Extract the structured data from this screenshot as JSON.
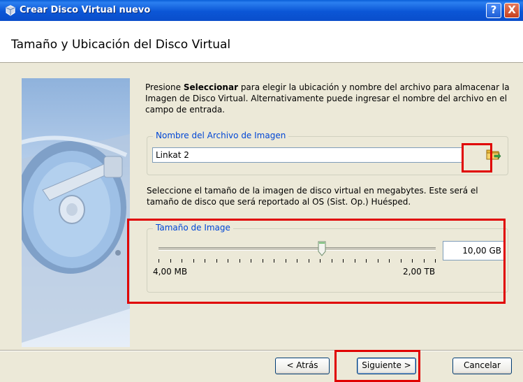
{
  "window": {
    "title": "Crear Disco Virtual nuevo",
    "help_label": "?",
    "close_label": "X"
  },
  "header": {
    "page_title": "Tamaño y Ubicación del Disco Virtual"
  },
  "instructions": {
    "prefix": "Presione ",
    "bold": "Seleccionar",
    "suffix": " para elegir la ubicación y nombre del archivo para almacenar la Imagen de Disco Virtual. Alternativamente puede ingresar el nombre del archivo en el campo de entrada."
  },
  "file_group": {
    "label": "Nombre del Archivo de Imagen",
    "value": "Linkat 2"
  },
  "size_text": "Seleccione el tamaño de la imagen de disco virtual en megabytes. Este será el tamaño de disco que será reportado al OS (Sist. Op.) Huésped.",
  "size_group": {
    "label": "Tamaño de Image",
    "min_label": "4,00 MB",
    "max_label": "2,00 TB",
    "value": "10,00 GB",
    "slider_position_fraction": 0.59
  },
  "buttons": {
    "back": "< Atrás",
    "next": "Siguiente >",
    "cancel": "Cancelar"
  },
  "colors": {
    "titlebar": "#0a4ecb",
    "group_label": "#0046d5",
    "highlight": "#e00000"
  }
}
